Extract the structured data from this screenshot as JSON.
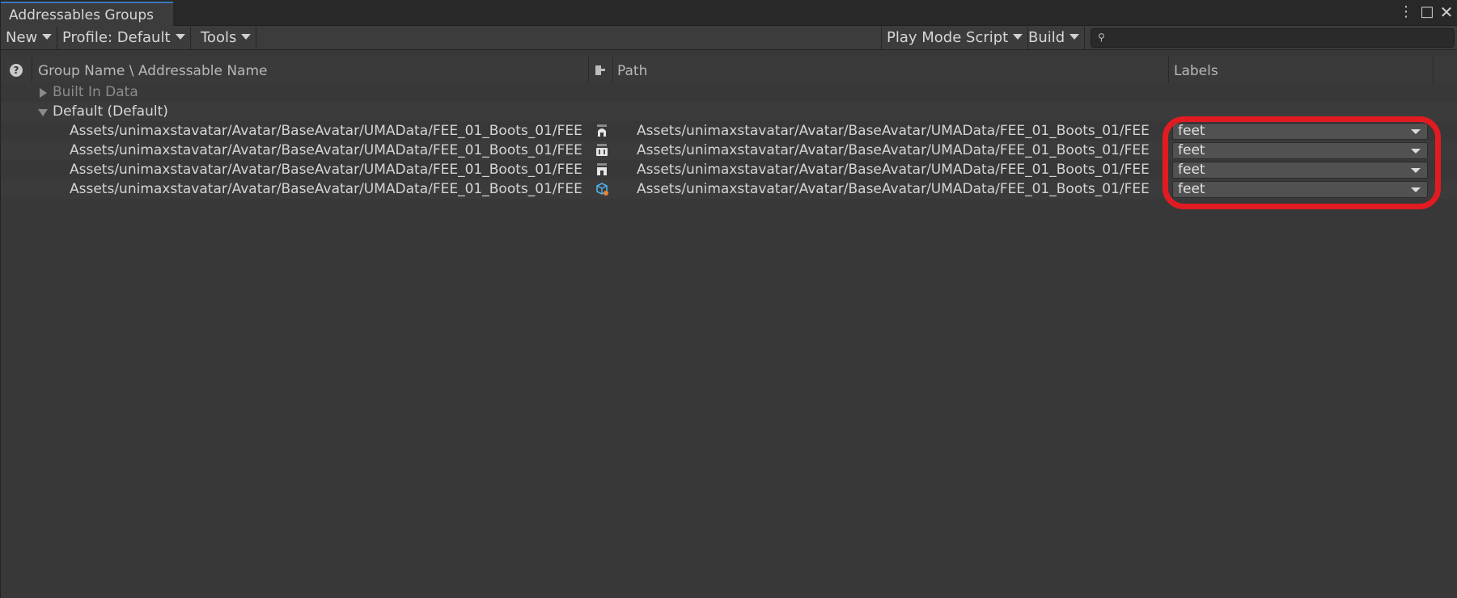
{
  "window": {
    "tab_title": "Addressables Groups",
    "controls": {
      "menu": "⋮",
      "maximize": "□",
      "close": "✕"
    }
  },
  "toolbar": {
    "new_label": "New",
    "profile_label": "Profile: Default",
    "tools_label": "Tools",
    "play_mode_label": "Play Mode Script",
    "build_label": "Build",
    "search_placeholder": "",
    "search_value": ""
  },
  "columns": {
    "help": "?",
    "group_name": "Group Name \\ Addressable Name",
    "path": "Path",
    "labels": "Labels"
  },
  "groups": [
    {
      "name": "Built In Data",
      "expanded": false
    },
    {
      "name": "Default (Default)",
      "expanded": true
    }
  ],
  "entries": [
    {
      "name": "Assets/unimaxstavatar/Avatar/BaseAvatar/UMAData/FEE_01_Boots_01/FEE",
      "path": "Assets/unimaxstavatar/Avatar/BaseAvatar/UMAData/FEE_01_Boots_01/FEE",
      "label": "feet",
      "icon": "uma-boot-icon"
    },
    {
      "name": "Assets/unimaxstavatar/Avatar/BaseAvatar/UMAData/FEE_01_Boots_01/FEE",
      "path": "Assets/unimaxstavatar/Avatar/BaseAvatar/UMAData/FEE_01_Boots_01/FEE",
      "label": "feet",
      "icon": "uma-slot-icon"
    },
    {
      "name": "Assets/unimaxstavatar/Avatar/BaseAvatar/UMAData/FEE_01_Boots_01/FEE",
      "path": "Assets/unimaxstavatar/Avatar/BaseAvatar/UMAData/FEE_01_Boots_01/FEE",
      "label": "feet",
      "icon": "uma-wardrobe-icon"
    },
    {
      "name": "Assets/unimaxstavatar/Avatar/BaseAvatar/UMAData/FEE_01_Boots_01/FEE",
      "path": "Assets/unimaxstavatar/Avatar/BaseAvatar/UMAData/FEE_01_Boots_01/FEE",
      "label": "feet",
      "icon": "mesh-asset-icon"
    }
  ],
  "colors": {
    "background": "#383838",
    "highlight": "#e11b22",
    "tab_accent": "#3a79bb"
  }
}
